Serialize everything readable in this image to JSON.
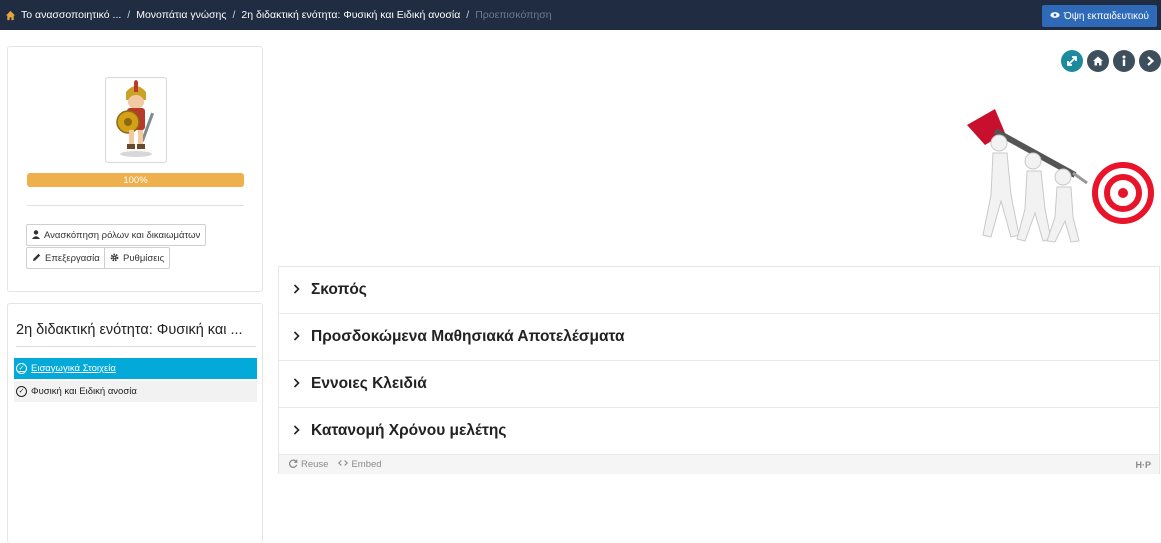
{
  "breadcrumb": {
    "items": [
      "Το ανασσοποιητικό ...",
      "Μονοπάτια γνώσης",
      "2η διδακτική ενότητα: Φυσική και Ειδική ανοσία",
      "Προεπισκόπηση"
    ]
  },
  "header": {
    "teacher_view_label": "Όψη εκπαιδευτικού"
  },
  "profile": {
    "progress_label": "100%",
    "progress_value": 1.0,
    "roles_button": "Ανασκόπηση ρόλων και δικαιωμάτων",
    "edit_button": "Επεξεργασία",
    "settings_button": "Ρυθμίσεις"
  },
  "toc": {
    "title": "2η διδακτική ενότητα: Φυσική και ...",
    "items": [
      {
        "label": "Εισαγωγικά Στοιχεία",
        "active": true
      },
      {
        "label": "Φυσική και Ειδική ανοσία",
        "active": false
      }
    ]
  },
  "accordion": {
    "items": [
      {
        "label": "Σκοπός"
      },
      {
        "label": "Προσδοκώμενα Μαθησιακά Αποτελέσματα"
      },
      {
        "label": "Εννοιες Κλειδιά"
      },
      {
        "label": "Κατανομή Χρόνου μελέτης"
      }
    ],
    "footer": {
      "reuse": "Reuse",
      "embed": "Embed",
      "brand": "H·P"
    }
  },
  "colors": {
    "topbar": "#1f2c42",
    "teacher_button": "#2f6ab8",
    "progress": "#eeb04d",
    "toc_active": "#03a9d8",
    "control_teal": "#1d8a9e",
    "control_dark": "#3d4f5c",
    "target_red": "#e8142a"
  },
  "icons": {
    "controls": [
      "expand-icon",
      "home-icon",
      "info-icon",
      "chevron-right-icon"
    ]
  }
}
